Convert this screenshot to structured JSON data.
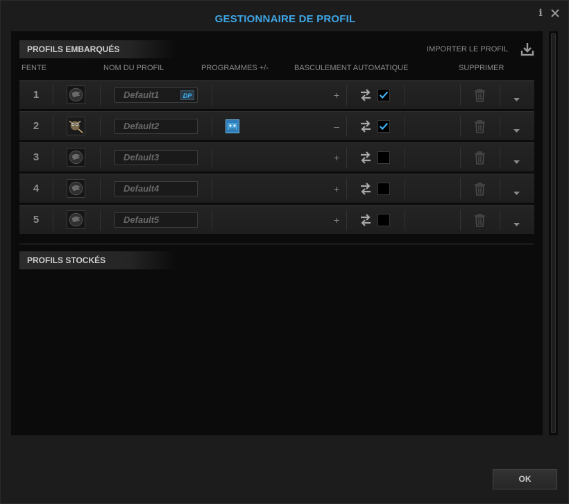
{
  "window": {
    "title": "GESTIONNAIRE DE PROFIL"
  },
  "onboard": {
    "section_title": "PROFILS EMBARQUÉS",
    "import_label": "IMPORTER LE PROFIL",
    "columns": {
      "slot": "FENTE",
      "name": "NOM DU PROFIL",
      "programs": "PROGRAMMES +/-",
      "auto_switch": "BASCULEMENT AUTOMATIQUE",
      "delete": "SUPPRIMER"
    },
    "rows": [
      {
        "slot": "1",
        "name": "Default1",
        "badge": "DP",
        "thumbnail": "roccat-logo",
        "program_icon": "",
        "action": "+",
        "auto_switch": true
      },
      {
        "slot": "2",
        "name": "Default2",
        "badge": "",
        "thumbnail": "gimp-icon",
        "program_icon": "program-icon",
        "action": "–",
        "auto_switch": true
      },
      {
        "slot": "3",
        "name": "Default3",
        "badge": "",
        "thumbnail": "roccat-logo",
        "program_icon": "",
        "action": "+",
        "auto_switch": false
      },
      {
        "slot": "4",
        "name": "Default4",
        "badge": "",
        "thumbnail": "roccat-logo",
        "program_icon": "",
        "action": "+",
        "auto_switch": false
      },
      {
        "slot": "5",
        "name": "Default5",
        "badge": "",
        "thumbnail": "roccat-logo",
        "program_icon": "",
        "action": "+",
        "auto_switch": false
      }
    ]
  },
  "stored": {
    "section_title": "PROFILS STOCKÉS"
  },
  "footer": {
    "ok_label": "OK"
  },
  "colors": {
    "accent": "#3fa6e6",
    "check": "#3fb7ff"
  }
}
